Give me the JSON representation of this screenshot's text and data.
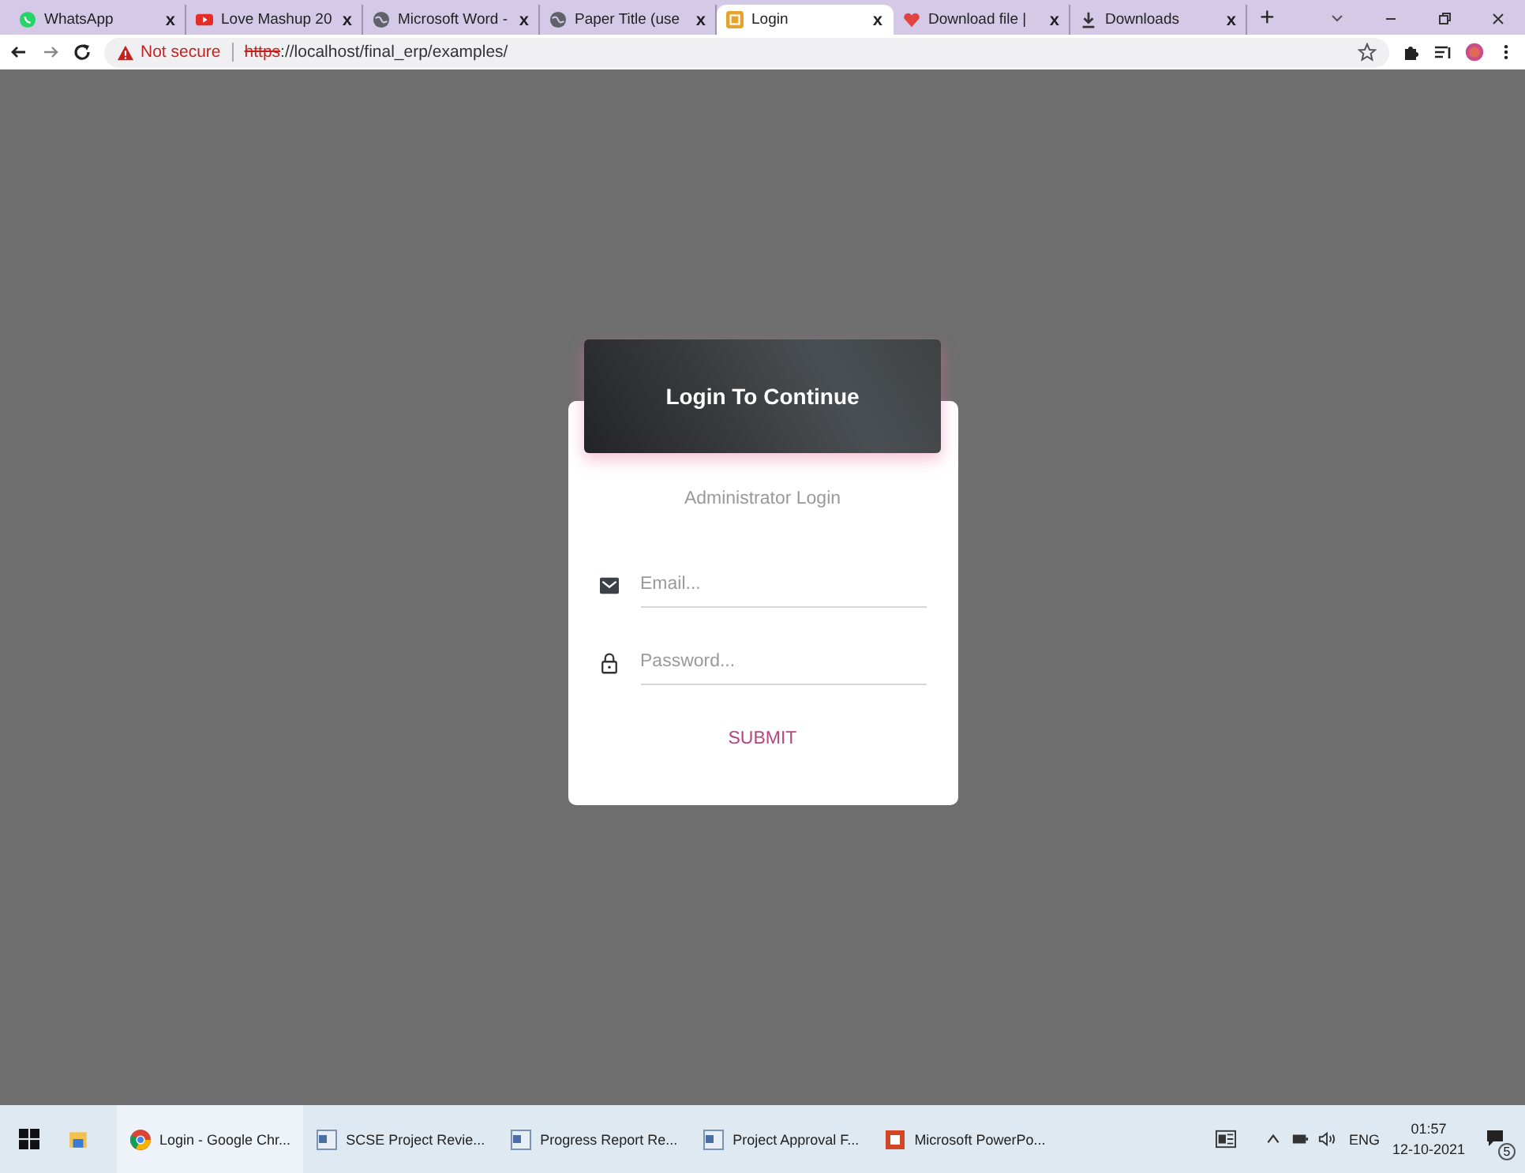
{
  "browser": {
    "tabs": [
      {
        "title": "WhatsApp",
        "close": "x",
        "selected": false
      },
      {
        "title": "Love Mashup 20",
        "close": "x",
        "selected": false
      },
      {
        "title": "Microsoft Word -",
        "close": "x",
        "selected": false
      },
      {
        "title": "Paper Title (use",
        "close": "x",
        "selected": false
      },
      {
        "title": "Login",
        "close": "x",
        "selected": true
      },
      {
        "title": "Download file |",
        "close": "x",
        "selected": false
      },
      {
        "title": "Downloads",
        "close": "x",
        "selected": false
      }
    ],
    "new_tab": "+",
    "security": "Not secure",
    "url_scheme": "https",
    "url_rest": "://localhost/final_erp/examples/"
  },
  "login": {
    "title": "Login To Continue",
    "subtitle": "Administrator Login",
    "fields": [
      {
        "kind": "email",
        "placeholder": "Email..."
      },
      {
        "kind": "password",
        "placeholder": "Password..."
      }
    ],
    "submit": "SUBMIT"
  },
  "taskbar": {
    "apps": [
      {
        "label": "Login - Google Chr...",
        "selected": true
      },
      {
        "label": "SCSE Project Revie...",
        "selected": false
      },
      {
        "label": "Progress Report Re...",
        "selected": false
      },
      {
        "label": "Project Approval F...",
        "selected": false
      },
      {
        "label": "Microsoft PowerPo...",
        "selected": false
      }
    ],
    "language": "ENG",
    "time": "01:57",
    "date": "12-10-2021",
    "notifications": "5"
  }
}
